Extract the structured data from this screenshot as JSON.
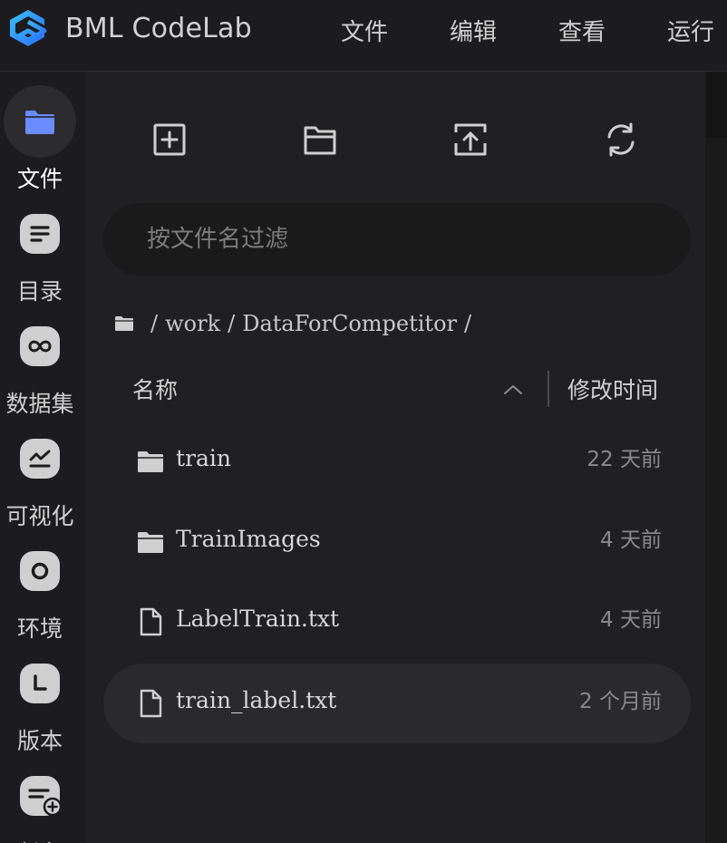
{
  "app": {
    "title": "BML CodeLab",
    "accent": "#2f8bff",
    "menu": [
      "文件",
      "编辑",
      "查看",
      "运行"
    ]
  },
  "sidebar": {
    "items": [
      {
        "label": "文件",
        "icon": "folder-icon",
        "active": true
      },
      {
        "label": "目录",
        "icon": "toc-icon"
      },
      {
        "label": "数据集",
        "icon": "dataset-icon"
      },
      {
        "label": "可视化",
        "icon": "chart-icon"
      },
      {
        "label": "环境",
        "icon": "environment-icon"
      },
      {
        "label": "版本",
        "icon": "version-icon"
      },
      {
        "label": "任务",
        "icon": "task-icon"
      }
    ]
  },
  "files": {
    "toolbar": [
      "new-file-icon",
      "new-folder-icon",
      "upload-icon",
      "refresh-icon"
    ],
    "filter_placeholder": "按文件名过滤",
    "breadcrumb": [
      "work",
      "DataForCompetitor"
    ],
    "columns": {
      "name": "名称",
      "modified": "修改时间"
    },
    "rows": [
      {
        "name": "train",
        "type": "folder",
        "modified": "22 天前"
      },
      {
        "name": "TrainImages",
        "type": "folder",
        "modified": "4 天前"
      },
      {
        "name": "LabelTrain.txt",
        "type": "file",
        "modified": "4 天前"
      },
      {
        "name": "train_label.txt",
        "type": "file",
        "modified": "2 个月前",
        "selected": true
      }
    ]
  }
}
